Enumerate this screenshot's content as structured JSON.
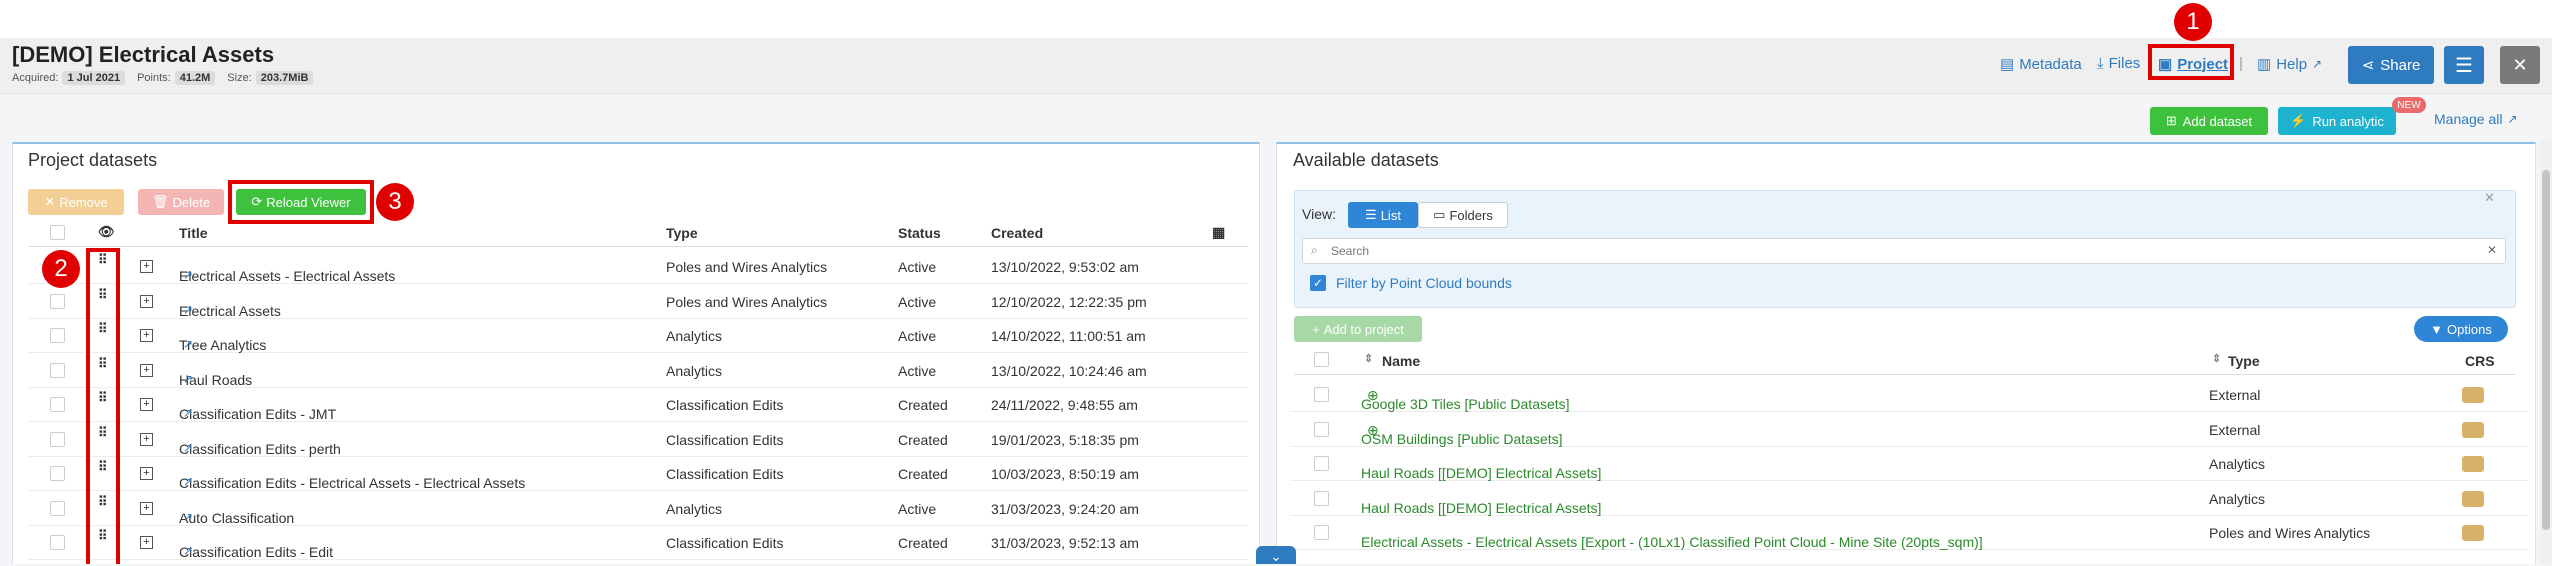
{
  "header": {
    "title": "[DEMO] Electrical Assets",
    "acquired_label": "Acquired:",
    "acquired_value": "1 Jul 2021",
    "points_label": "Points:",
    "points_value": "41.2M",
    "size_label": "Size:",
    "size_value": "203.7MiB",
    "metadata_label": "Metadata",
    "files_label": "Files",
    "project_label": "Project",
    "help_label": "Help",
    "share_label": "Share"
  },
  "actions": {
    "add_dataset": "Add dataset",
    "run_analytic": "Run analytic",
    "new_badge": "NEW",
    "manage_all": "Manage all"
  },
  "annotations": {
    "badge1": "1",
    "badge2": "2",
    "badge3": "3"
  },
  "project_datasets": {
    "title": "Project datasets",
    "remove_label": "Remove",
    "delete_label": "Delete",
    "reload_label": "Reload Viewer",
    "columns": {
      "title": "Title",
      "type": "Type",
      "status": "Status",
      "created": "Created"
    },
    "rows": [
      {
        "title": "Electrical Assets - Electrical Assets",
        "type": "Poles and Wires Analytics",
        "status": "Active",
        "created": "13/10/2022, 9:53:02 am"
      },
      {
        "title": "Electrical Assets",
        "type": "Poles and Wires Analytics",
        "status": "Active",
        "created": "12/10/2022, 12:22:35 pm"
      },
      {
        "title": "Tree Analytics",
        "type": "Analytics",
        "status": "Active",
        "created": "14/10/2022, 11:00:51 am"
      },
      {
        "title": "Haul Roads",
        "type": "Analytics",
        "status": "Active",
        "created": "13/10/2022, 10:24:46 am"
      },
      {
        "title": "Classification Edits - JMT",
        "type": "Classification Edits",
        "status": "Created",
        "created": "24/11/2022, 9:48:55 am"
      },
      {
        "title": "Classification Edits - perth",
        "type": "Classification Edits",
        "status": "Created",
        "created": "19/01/2023, 5:18:35 pm"
      },
      {
        "title": "Classification Edits - Electrical Assets - Electrical Assets",
        "type": "Classification Edits",
        "status": "Created",
        "created": "10/03/2023, 8:50:19 am"
      },
      {
        "title": "Auto Classification",
        "type": "Analytics",
        "status": "Active",
        "created": "31/03/2023, 9:24:20 am"
      },
      {
        "title": "Classification Edits - Edit",
        "type": "Classification Edits",
        "status": "Created",
        "created": "31/03/2023, 9:52:13 am"
      }
    ]
  },
  "available_datasets": {
    "title": "Available datasets",
    "view_label": "View:",
    "list_label": "List",
    "folders_label": "Folders",
    "search_placeholder": "Search",
    "filter_label": "Filter by Point Cloud bounds",
    "add_to_project": "Add to project",
    "options_label": "Options",
    "columns": {
      "name": "Name",
      "type": "Type",
      "crs": "CRS"
    },
    "rows": [
      {
        "name": "Google 3D Tiles [Public Datasets]",
        "type": "External"
      },
      {
        "name": "OSM Buildings [Public Datasets]",
        "type": "External"
      },
      {
        "name": "Haul Roads [[DEMO] Electrical Assets]",
        "type": "Analytics"
      },
      {
        "name": "Haul Roads [[DEMO] Electrical Assets]",
        "type": "Analytics"
      },
      {
        "name": "Electrical Assets - Electrical Assets [Export - (10Lx1) Classified Point Cloud - Mine Site (20pts_sqm)]",
        "type": "Poles and Wires Analytics"
      }
    ]
  }
}
